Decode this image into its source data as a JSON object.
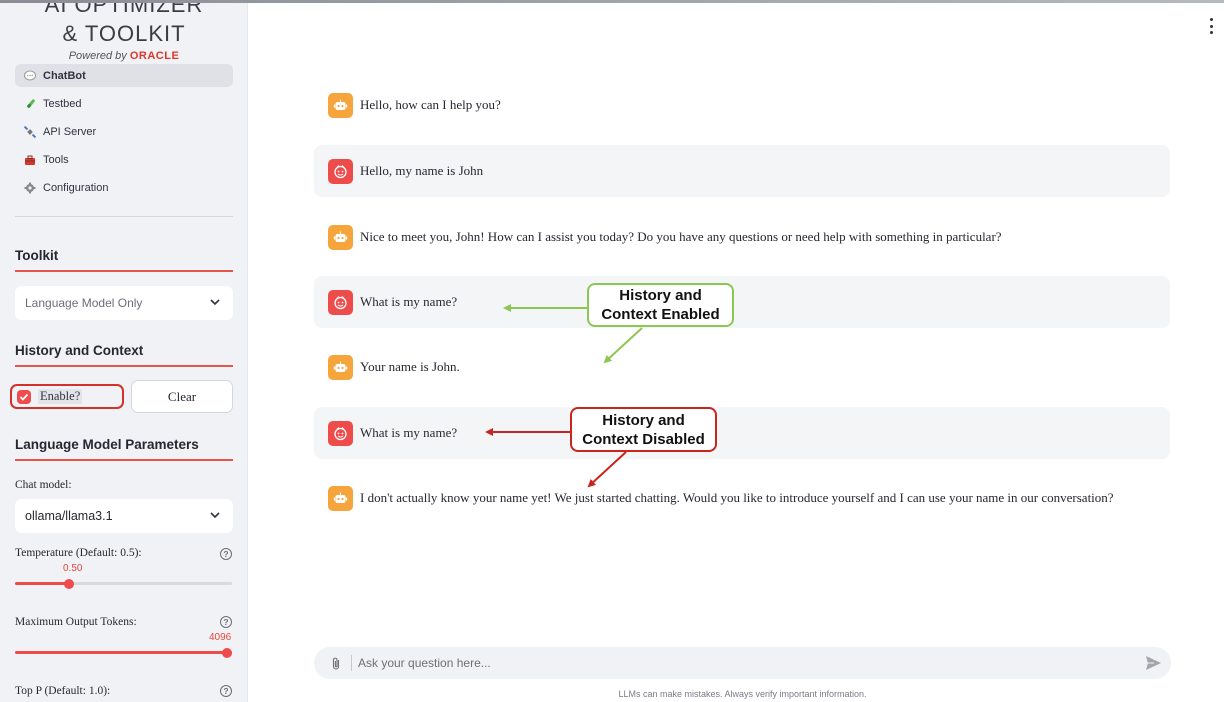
{
  "logo": {
    "line1": "AI OPTIMIZER",
    "line2": "& TOOLKIT",
    "powered_by": "Powered by ",
    "oracle": "ORACLE"
  },
  "nav": [
    {
      "label": "ChatBot",
      "icon": "chat-bubble-icon",
      "active": true
    },
    {
      "label": "Testbed",
      "icon": "test-tube-icon",
      "active": false
    },
    {
      "label": "API Server",
      "icon": "satellite-icon",
      "active": false
    },
    {
      "label": "Tools",
      "icon": "toolbox-icon",
      "active": false
    },
    {
      "label": "Configuration",
      "icon": "gear-icon",
      "active": false
    }
  ],
  "toolkit": {
    "heading": "Toolkit",
    "selected": "Language Model Only"
  },
  "history": {
    "heading": "History and Context",
    "enable_label": "Enable?",
    "enabled": true,
    "clear_label": "Clear"
  },
  "params": {
    "heading": "Language Model Parameters",
    "chat_model_label": "Chat model:",
    "chat_model": "ollama/llama3.1",
    "temperature_label": "Temperature (Default: 0.5):",
    "temperature_value": "0.50",
    "temperature_fraction": 0.25,
    "max_tokens_label": "Maximum Output Tokens:",
    "max_tokens_value": "4096",
    "max_tokens_fraction": 1.0,
    "top_p_label": "Top P (Default: 1.0):"
  },
  "messages": [
    {
      "role": "assistant",
      "text": "Hello, how can I help you?"
    },
    {
      "role": "user",
      "text": "Hello, my name is John"
    },
    {
      "role": "assistant",
      "text": "Nice to meet you, John! How can I assist you today? Do you have any questions or need help with something in particular?"
    },
    {
      "role": "user",
      "text": "What is my name?"
    },
    {
      "role": "assistant",
      "text": "Your name is John."
    },
    {
      "role": "user",
      "text": "What is my name?"
    },
    {
      "role": "assistant",
      "text": "I don't actually know your name yet! We just started chatting. Would you like to introduce yourself and I can use your name in our conversation?"
    }
  ],
  "callouts": {
    "enabled_line1": "History and",
    "enabled_line2": "Context Enabled",
    "disabled_line1": "History and",
    "disabled_line2": "Context Disabled",
    "enabled_color": "#8cc653",
    "disabled_color": "#c9251c"
  },
  "chat_input": {
    "placeholder": "Ask your question here...",
    "disclaimer": "LLMs can make mistakes. Always verify important information."
  },
  "colors": {
    "accent": "#ef4b4b",
    "bot_avatar": "#f5a53b",
    "user_avatar": "#ee4b4b"
  }
}
